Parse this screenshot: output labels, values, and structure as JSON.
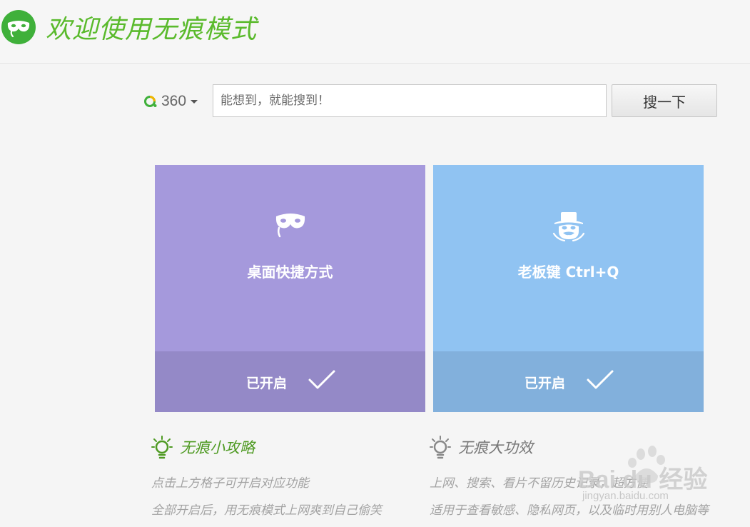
{
  "header": {
    "title": "欢迎使用无痕模式",
    "logo_icon": "mask-icon"
  },
  "search": {
    "engine_name": "360",
    "placeholder": "能想到，就能搜到！",
    "button_label": "搜一下"
  },
  "cards": [
    {
      "label": "桌面快捷方式",
      "status": "已开启",
      "icon": "mask-icon",
      "color": "#a599dc"
    },
    {
      "label": "老板键 Ctrl+Q",
      "status": "已开启",
      "icon": "boss-icon",
      "color": "#90c3f2"
    }
  ],
  "tips": [
    {
      "title": "无痕小攻略",
      "lines": [
        "点击上方格子可开启对应功能",
        "全部开启后，用无痕模式上网爽到自己偷笑"
      ],
      "accent": "#4e9a22"
    },
    {
      "title": "无痕大功效",
      "lines": [
        "上网、搜索、看片不留历史记录，超方便",
        "适用于查看敏感、隐私网页，以及临时用别人电脑等"
      ],
      "accent": "#777777"
    }
  ],
  "watermark": {
    "brand": "Bai du 经验",
    "url": "jingyan.baidu.com"
  }
}
